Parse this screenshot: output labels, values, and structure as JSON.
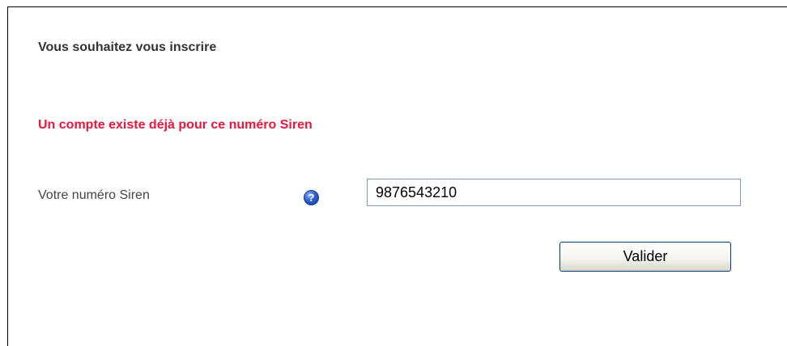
{
  "form": {
    "title": "Vous souhaitez vous inscrire",
    "error_message": "Un compte existe déjà pour ce numéro Siren",
    "siren_label": "Votre numéro Siren",
    "help_icon_glyph": "?",
    "siren_value": "9876543210",
    "submit_label": "Valider"
  },
  "colors": {
    "error": "#e8173c",
    "title": "#333333",
    "label": "#444444",
    "help_icon": "#2f5fd0",
    "input_border": "#7f9db9",
    "button_border": "#003c74"
  },
  "icons": {
    "help": "help-icon"
  }
}
